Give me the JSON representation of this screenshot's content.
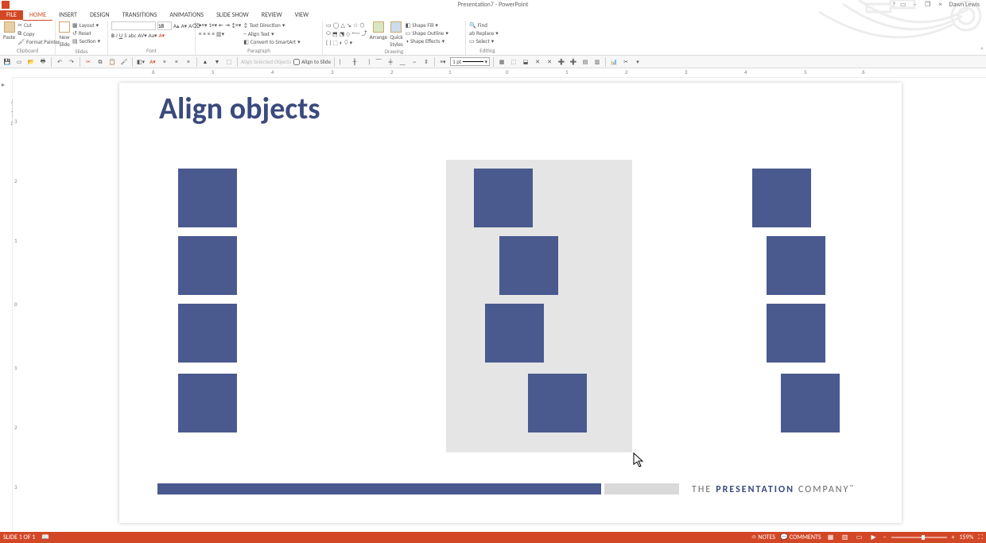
{
  "window": {
    "title": "Presentation7 - PowerPoint",
    "user": "Dawn Lewis",
    "help": "?",
    "ribbon_opts": "▭",
    "min": "–",
    "restore": "❐",
    "close": "×"
  },
  "tabs": [
    "FILE",
    "HOME",
    "INSERT",
    "DESIGN",
    "TRANSITIONS",
    "ANIMATIONS",
    "SLIDE SHOW",
    "REVIEW",
    "VIEW"
  ],
  "active_tab": "HOME",
  "ribbon": {
    "clipboard": {
      "label": "Clipboard",
      "paste": "Paste",
      "cut": "Cut",
      "copy": "Copy",
      "format_painter": "Format Painter"
    },
    "slides": {
      "label": "Slides",
      "new": "New\nSlide",
      "layout": "Layout",
      "reset": "Reset",
      "section": "Section"
    },
    "font": {
      "label": "Font",
      "name": "",
      "size": "18"
    },
    "paragraph": {
      "label": "Paragraph",
      "text_dir": "Text Direction",
      "align_text": "Align Text",
      "smartart": "Convert to SmartArt"
    },
    "drawing": {
      "label": "Drawing",
      "arrange": "Arrange",
      "quick": "Quick\nStyles",
      "fill": "Shape Fill",
      "outline": "Shape Outline",
      "effects": "Shape Effects"
    },
    "editing": {
      "label": "Editing",
      "find": "Find",
      "replace": "Replace",
      "select": "Select"
    }
  },
  "qat2": {
    "align_selected": "Align Selected Objects",
    "align_slide": "Align to Slide",
    "weight": "1 pt"
  },
  "ruler_h": [
    "6",
    "5",
    "4",
    "3",
    "2",
    "1",
    "0",
    "1",
    "2",
    "3",
    "4",
    "5",
    "6"
  ],
  "ruler_v": [
    "3",
    "2",
    "1",
    "0",
    "1",
    "2",
    "3"
  ],
  "thumbs_label": "Thumbnails",
  "slide": {
    "title": "Align objects",
    "company_pre": "THE",
    "company_mid": "PRESENTATION",
    "company_post": "COMPANY",
    "tm": "™"
  },
  "status": {
    "slide": "SLIDE 1 OF 1",
    "lang": "",
    "notes": "NOTES",
    "comments": "COMMENTS",
    "zoom": "159%"
  }
}
